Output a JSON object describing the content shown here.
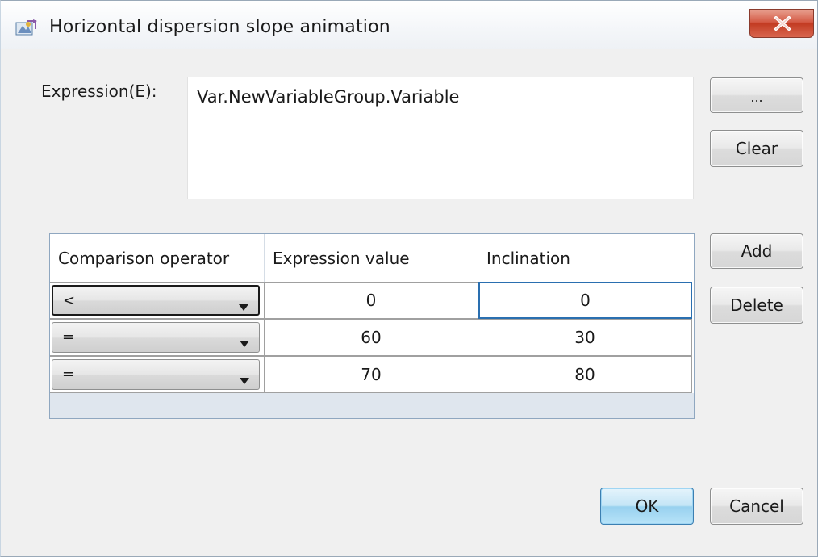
{
  "window": {
    "title": "Horizontal dispersion slope animation",
    "close_glyph": "✕"
  },
  "expression": {
    "label": "Expression(E):",
    "value": "Var.NewVariableGroup.Variable",
    "browse_label": "...",
    "clear_label": "Clear"
  },
  "table": {
    "columns": [
      "Comparison operator",
      "Expression value",
      "Inclination"
    ],
    "rows": [
      {
        "operator": "<",
        "value": "0",
        "inclination": "0"
      },
      {
        "operator": "=",
        "value": "60",
        "inclination": "30"
      },
      {
        "operator": "=",
        "value": "70",
        "inclination": "80"
      }
    ],
    "add_label": "Add",
    "delete_label": "Delete"
  },
  "footer": {
    "ok_label": "OK",
    "cancel_label": "Cancel"
  },
  "colors": {
    "close_button": "#c8442c",
    "default_button": "#98d1ef",
    "selected_cell_border": "#2a6fb0"
  },
  "icons": {
    "title": "animation-app-icon",
    "close": "close-icon",
    "dropdown": "chevron-down-icon"
  }
}
